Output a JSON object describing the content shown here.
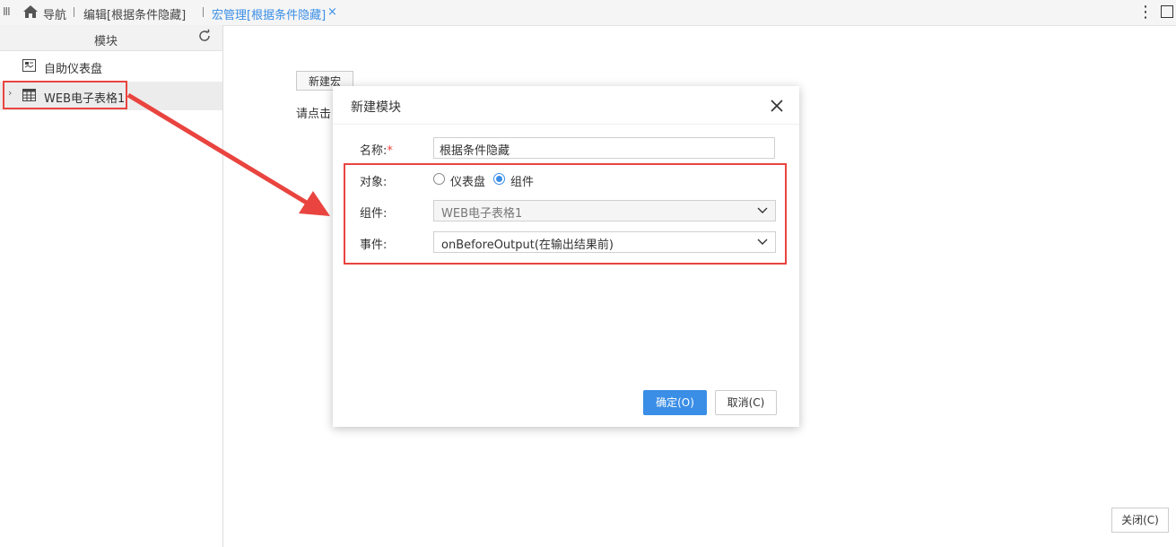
{
  "topbar": {
    "tabs": [
      "导航",
      "编辑[根据条件隐藏]",
      "宏管理[根据条件隐藏]"
    ],
    "close_tab": "×",
    "more": "⋮"
  },
  "left_panel": {
    "title": "模块",
    "items": [
      {
        "label": "自助仪表盘",
        "icon": "dashboard-icon"
      },
      {
        "label": "WEB电子表格1",
        "icon": "spreadsheet-icon"
      }
    ]
  },
  "main": {
    "new_macro_button": "新建宏",
    "hint": "请点击",
    "close_button": "关闭(C)"
  },
  "dialog": {
    "title": "新建模块",
    "name_label": "名称:",
    "required_mark": "*",
    "name_value": "根据条件隐藏",
    "object_label": "对象:",
    "object_options": [
      "仪表盘",
      "组件"
    ],
    "object_selected": "组件",
    "component_label": "组件:",
    "component_value": "WEB电子表格1",
    "event_label": "事件:",
    "event_value": "onBeforeOutput(在输出结果前)",
    "ok_button": "确定(O)",
    "cancel_button": "取消(C)"
  },
  "colors": {
    "accent": "#3a8ee6",
    "highlight": "#e9443f"
  }
}
